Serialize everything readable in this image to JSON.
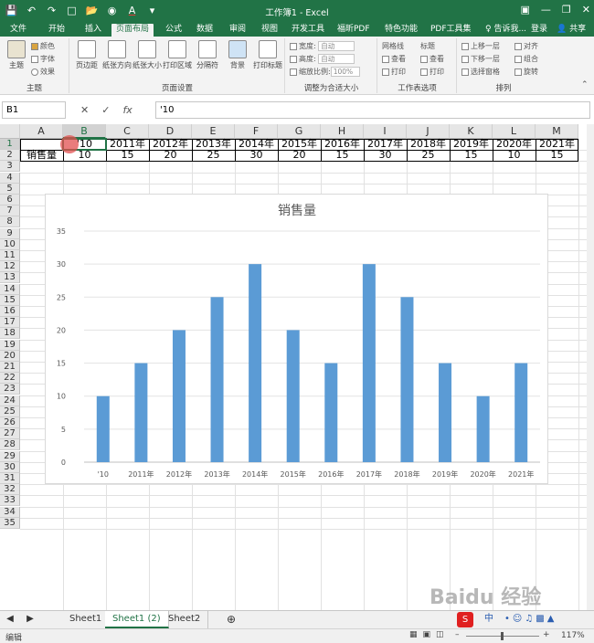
{
  "window": {
    "title": "工作簿1 - Excel"
  },
  "ribbon_tabs": [
    "文件",
    "开始",
    "插入",
    "页面布局",
    "公式",
    "数据",
    "审阅",
    "视图",
    "开发工具",
    "福昕PDF",
    "特色功能",
    "PDF工具集"
  ],
  "ribbon_tab_active": "页面布局",
  "tell_me": "♀ 告诉我...",
  "login": "登录",
  "share": "共享",
  "ribbon": {
    "theme_group": {
      "label": "主题",
      "theme_btn": "主题",
      "colors": "颜色",
      "fonts": "字体",
      "effects": "效果"
    },
    "page_setup": {
      "label": "页面设置",
      "buttons": [
        "页边距",
        "纸张方向",
        "纸张大小",
        "打印区域",
        "分隔符",
        "背景",
        "打印标题"
      ]
    },
    "scale_fit": {
      "label": "调整为合适大小",
      "width_label": "宽度:",
      "width_value": "自动",
      "height_label": "高度:",
      "height_value": "自动",
      "scale_label": "缩放比例:",
      "scale_value": "100%"
    },
    "sheet_options": {
      "label": "工作表选项",
      "gridlines": "网格线",
      "headings": "标题",
      "view": "查看",
      "print": "打印"
    },
    "arrange": {
      "label": "排列",
      "forward": "上移一层",
      "backward": "下移一层",
      "selection_pane": "选择窗格",
      "align": "对齐",
      "group": "组合",
      "rotate": "旋转"
    }
  },
  "formula_bar": {
    "name_box": "B1",
    "formula": "'10"
  },
  "columns": [
    "A",
    "B",
    "C",
    "D",
    "E",
    "F",
    "G",
    "H",
    "I",
    "J",
    "K",
    "L",
    "M"
  ],
  "rows": [
    "1",
    "2",
    "3",
    "4",
    "5",
    "6",
    "7",
    "8",
    "9",
    "10",
    "11",
    "12",
    "13",
    "14",
    "15",
    "16",
    "17",
    "18",
    "19",
    "20",
    "21",
    "22",
    "23",
    "24",
    "25",
    "26",
    "27",
    "28",
    "29",
    "30",
    "31",
    "32",
    "33",
    "34",
    "35"
  ],
  "row1": [
    "",
    "'10",
    "2011年",
    "2012年",
    "2013年",
    "2014年",
    "2015年",
    "2016年",
    "2017年",
    "2018年",
    "2019年",
    "2020年",
    "2021年"
  ],
  "row2": [
    "销售量",
    "10",
    "15",
    "20",
    "25",
    "30",
    "20",
    "15",
    "30",
    "25",
    "15",
    "10",
    "15"
  ],
  "chart_data": {
    "type": "bar",
    "title": "销售量",
    "categories": [
      "'10",
      "2011年",
      "2012年",
      "2013年",
      "2014年",
      "2015年",
      "2016年",
      "2017年",
      "2018年",
      "2019年",
      "2020年",
      "2021年"
    ],
    "values": [
      10,
      15,
      20,
      25,
      30,
      20,
      15,
      30,
      25,
      15,
      10,
      15
    ],
    "ylim": [
      0,
      35
    ],
    "yticks": [
      "0",
      "5",
      "10",
      "15",
      "20",
      "25",
      "30",
      "35"
    ],
    "grid": true,
    "bar_color": "#5b9bd5"
  },
  "sheet_tabs": [
    "Sheet1",
    "Sheet1 (2)",
    "Sheet2"
  ],
  "sheet_tab_active": "Sheet1 (2)",
  "status": {
    "mode": "编辑",
    "zoom": "117%"
  },
  "watermark": "Baidu 经验",
  "ime": {
    "indicator": "中"
  },
  "colors": {
    "excel_green": "#217346"
  }
}
